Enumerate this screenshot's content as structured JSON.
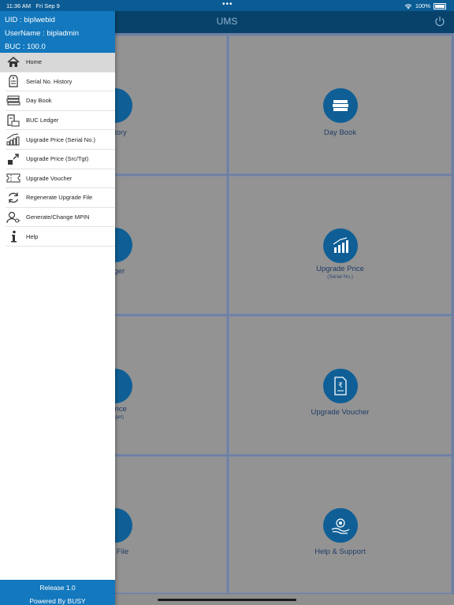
{
  "status_bar": {
    "time": "11:36 AM",
    "date": "Fri Sep 9",
    "dots": "•••",
    "battery": "100%"
  },
  "app": {
    "title": "UMS"
  },
  "tiles": [
    {
      "label": "Serial No. History",
      "visible_label": "History"
    },
    {
      "label": "Day Book"
    },
    {
      "label": "BUC Ledger",
      "visible_label": "edger"
    },
    {
      "label": "Upgrade Price",
      "sublabel": "(Serial No.)"
    },
    {
      "label": "Upgrade Price",
      "visible_label": "e Price",
      "sublabel": "(Target)"
    },
    {
      "label": "Upgrade Voucher"
    },
    {
      "label": "Regenerate Upgrade File",
      "visible_label": "rate File"
    },
    {
      "label": "Help & Support"
    }
  ],
  "drawer": {
    "uid": "UID : biplwebid",
    "username": "UserName : bipladmin",
    "buc": "BUC : 100.0",
    "items": [
      {
        "label": "Home",
        "icon": "home-icon"
      },
      {
        "label": "Serial No. History",
        "icon": "tag-icon"
      },
      {
        "label": "Day Book",
        "icon": "books-icon"
      },
      {
        "label": "BUC Ledger",
        "icon": "ledger-icon"
      },
      {
        "label": "Upgrade Price (Serial No.)",
        "icon": "bar-chart-icon"
      },
      {
        "label": "Upgrade Price (Src/Tgt)",
        "icon": "arrows-icon"
      },
      {
        "label": "Upgrade Voucher",
        "icon": "ticket-icon"
      },
      {
        "label": "Regenerate Upgrade File",
        "icon": "refresh-icon"
      },
      {
        "label": "Generate/Change MPIN",
        "icon": "user-key-icon"
      },
      {
        "label": "Help",
        "icon": "info-icon"
      }
    ],
    "release": "Release 1.0",
    "powered": "Powered By BUSY"
  }
}
